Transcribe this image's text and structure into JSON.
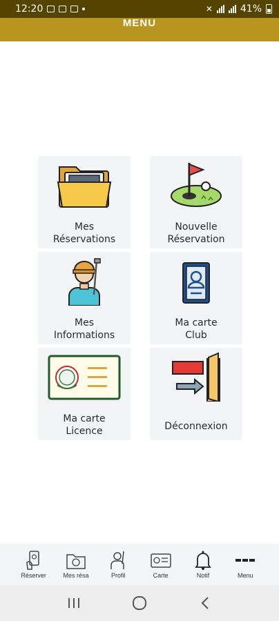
{
  "status_bar": {
    "time": "12:20",
    "battery": "41%"
  },
  "header": {
    "title": "MENU"
  },
  "tiles": [
    {
      "label": "Mes\nRéservations",
      "icon": "folder-icon"
    },
    {
      "label": "Nouvelle\nRéservation",
      "icon": "golf-flag-icon"
    },
    {
      "label": "Mes\nInformations",
      "icon": "golfer-icon"
    },
    {
      "label": "Ma carte\nClub",
      "icon": "id-card-icon"
    },
    {
      "label": "Ma carte\nLicence",
      "icon": "license-card-icon"
    },
    {
      "label": "Déconnexion",
      "icon": "exit-door-icon"
    }
  ],
  "bottom_nav": [
    {
      "label": "Réserver",
      "icon": "reserve-icon"
    },
    {
      "label": "Mes résa",
      "icon": "my-bookings-icon"
    },
    {
      "label": "Profil",
      "icon": "profile-icon"
    },
    {
      "label": "Carte",
      "icon": "card-icon"
    },
    {
      "label": "Notif",
      "icon": "bell-icon"
    },
    {
      "label": "Menu",
      "icon": "more-icon"
    }
  ],
  "colors": {
    "status_bar": "#544400",
    "header": "#b8951f",
    "tile_bg": "#f3f4f6"
  }
}
